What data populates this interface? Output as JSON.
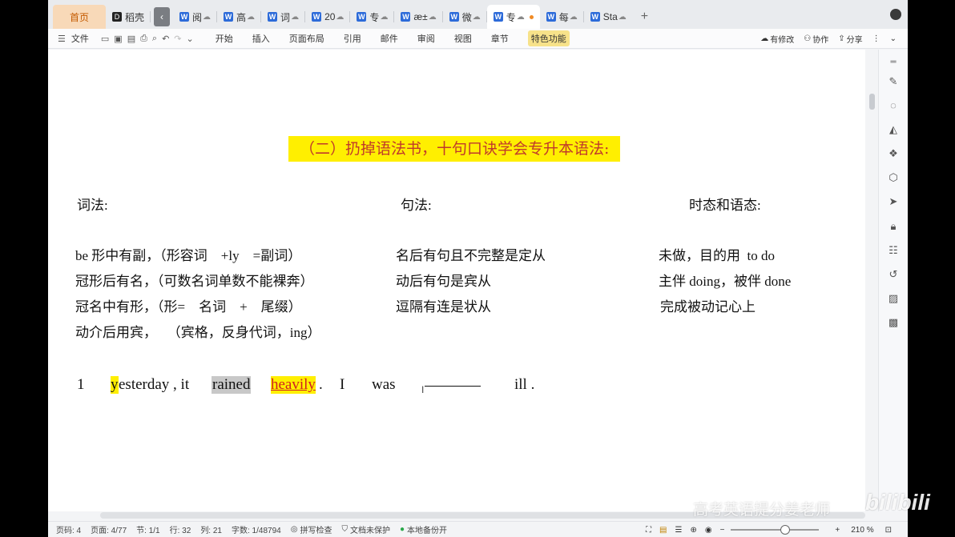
{
  "tabs": {
    "home": "首页",
    "daoke": "稻壳",
    "docs": [
      "阅",
      "高",
      "词",
      "20",
      "专",
      "æ±",
      "微",
      "专",
      "每",
      "Sta"
    ]
  },
  "toolbar": {
    "file": "文件",
    "menus": [
      "开始",
      "插入",
      "页面布局",
      "引用",
      "邮件",
      "审阅",
      "视图",
      "章节"
    ],
    "feature": "特色功能",
    "has_changes": "有修改",
    "collab": "协作",
    "share": "分享"
  },
  "doc": {
    "title": "（二）扔掉语法书，十句口诀学会专升本语法:",
    "cap1": "词法:",
    "cap2": "句法:",
    "cap3": "时态和语态:",
    "col1": [
      "be 形中有副，（形容词    +ly    =副词）",
      "冠形后有名，（可数名词单数不能裸奔）",
      "冠名中有形，（形=    名词    +    尾缀）",
      "动介后用宾，   （宾格，反身代词，ing）"
    ],
    "col2": [
      "名后有句且不完整是定从",
      "动后有句是宾从",
      "逗隔有连是状从"
    ],
    "col3": [
      "未做，目的用  to do",
      "主伴 doing，被伴 done",
      "完成被动记心上"
    ],
    "sentence": {
      "num": "1",
      "y": "y",
      "esterday": "esterday , it",
      "rained": "rained",
      "heavily": "heavily",
      "dot": ".",
      "I": "I",
      "was": "was",
      "ill": "ill ."
    }
  },
  "status": {
    "page_no": "页码: 4",
    "pages": "页面: 4/77",
    "section": "节: 1/1",
    "line": "行: 32",
    "col": "列: 21",
    "words": "字数: 1/48794",
    "spell": "拼写检查",
    "protect": "文档未保护",
    "backup": "本地备份开",
    "zoom": "210 %"
  },
  "watermark": {
    "text": "高考英语提分姜老师",
    "logo": "bilibili"
  }
}
